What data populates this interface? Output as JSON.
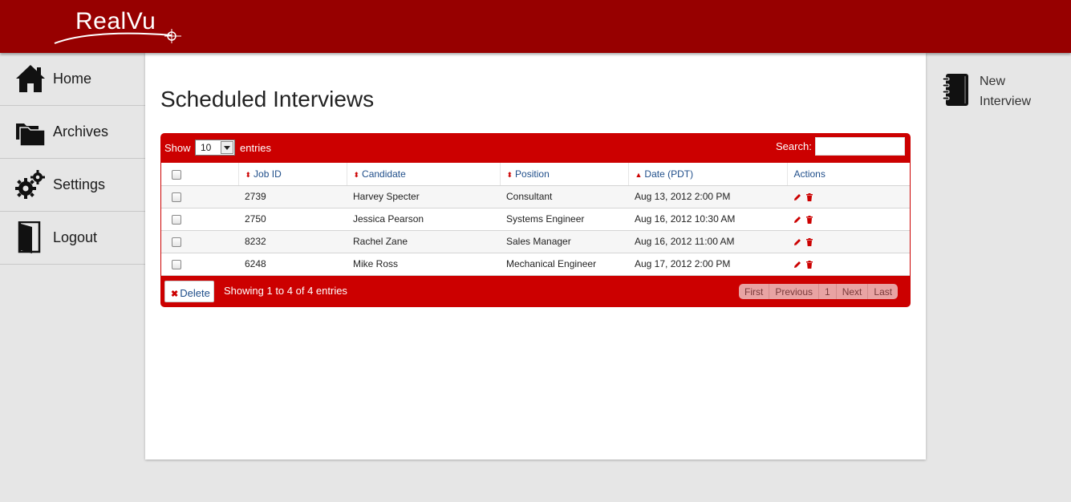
{
  "header": {
    "logo_text": "RealVu",
    "bg_color": "#970000"
  },
  "nav": {
    "items": [
      {
        "label": "Home",
        "icon": "home-icon"
      },
      {
        "label": "Archives",
        "icon": "folder-icon"
      },
      {
        "label": "Settings",
        "icon": "gears-icon"
      },
      {
        "label": "Logout",
        "icon": "door-icon"
      }
    ]
  },
  "main": {
    "title": "Scheduled Interviews",
    "show_label": "Show",
    "length_value": "10",
    "entries_label": "entries",
    "search_label": "Search:",
    "search_value": "",
    "columns": [
      "Job ID",
      "Candidate",
      "Position",
      "Date (PDT)",
      "Actions"
    ],
    "rows": [
      {
        "job_id": "2739",
        "candidate": "Harvey Specter",
        "position": "Consultant",
        "date": "Aug 13, 2012 2:00 PM"
      },
      {
        "job_id": "2750",
        "candidate": "Jessica Pearson",
        "position": "Systems Engineer",
        "date": "Aug 16, 2012 10:30 AM"
      },
      {
        "job_id": "8232",
        "candidate": "Rachel Zane",
        "position": "Sales Manager",
        "date": "Aug 16, 2012 11:00 AM"
      },
      {
        "job_id": "6248",
        "candidate": "Mike Ross",
        "position": "Mechanical Engineer",
        "date": "Aug 17, 2012 2:00 PM"
      }
    ],
    "delete_label": "Delete",
    "info": "Showing 1 to 4 of 4 entries",
    "pager": {
      "first": "First",
      "previous": "Previous",
      "page": "1",
      "next": "Next",
      "last": "Last"
    },
    "accent_color": "#cc0000"
  },
  "sidebar_right": {
    "new_interview_line1": "New",
    "new_interview_line2": "Interview",
    "icon": "notebook-icon"
  }
}
